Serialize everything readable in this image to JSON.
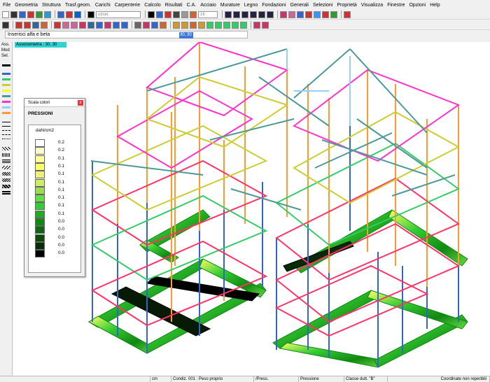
{
  "menu": [
    "File",
    "Geometria",
    "Struttura",
    "Trasf.geom.",
    "Carichi",
    "Carpenterie",
    "Calcolo",
    "Risultati",
    "C.A.",
    "Acciaio",
    "Murature",
    "Legno",
    "Fondazioni",
    "Generali",
    "Selezioni",
    "Proprietà",
    "Visualizza",
    "Finestre",
    "Opzioni",
    "Help"
  ],
  "toolbar1": {
    "font_field": "u|n|e|",
    "layer_value": "16"
  },
  "prompt": {
    "text": "Inserisci alfa e beta",
    "value": "30, 30"
  },
  "view_label": "Assonometria : 30, 30",
  "leftbar": {
    "labels": [
      "Ass.",
      "Mod",
      "Sel."
    ]
  },
  "colors": {
    "pink": "#ff33cc",
    "orange": "#ff9933",
    "blue": "#3366cc",
    "teal": "#4d9999",
    "yellow": "#cccc33",
    "green": "#33cc66",
    "red": "#ff3366",
    "lightblue": "#99ccff"
  },
  "scala": {
    "title": "Scala colori",
    "close": "x",
    "heading": "PRESSIONI",
    "unit": "daN/cm2",
    "bins": [
      {
        "color": "#ffffff",
        "value": "0.2"
      },
      {
        "color": "#ffffcc",
        "value": "0.2"
      },
      {
        "color": "#ffff99",
        "value": "0.1"
      },
      {
        "color": "#ffff66",
        "value": "0.1"
      },
      {
        "color": "#eef07a",
        "value": "0.1"
      },
      {
        "color": "#ccee66",
        "value": "0.1"
      },
      {
        "color": "#99dd55",
        "value": "0.1"
      },
      {
        "color": "#66dd44",
        "value": "0.1"
      },
      {
        "color": "#33cc33",
        "value": "0.1"
      },
      {
        "color": "#22aa22",
        "value": "0.1"
      },
      {
        "color": "#118811",
        "value": "0.0"
      },
      {
        "color": "#116611",
        "value": "0.0"
      },
      {
        "color": "#0b4b0b",
        "value": "0.0"
      },
      {
        "color": "#072e07",
        "value": "0.0"
      },
      {
        "color": "#000000",
        "value": "0.0"
      }
    ]
  },
  "status": {
    "unit": "cm",
    "condition": "Condiz. 001 : Peso proprio",
    "press": "/Press.",
    "field": "Pressione",
    "class": "Classe dutt. \"B\"",
    "coords": "Coordinate non reperibili"
  }
}
